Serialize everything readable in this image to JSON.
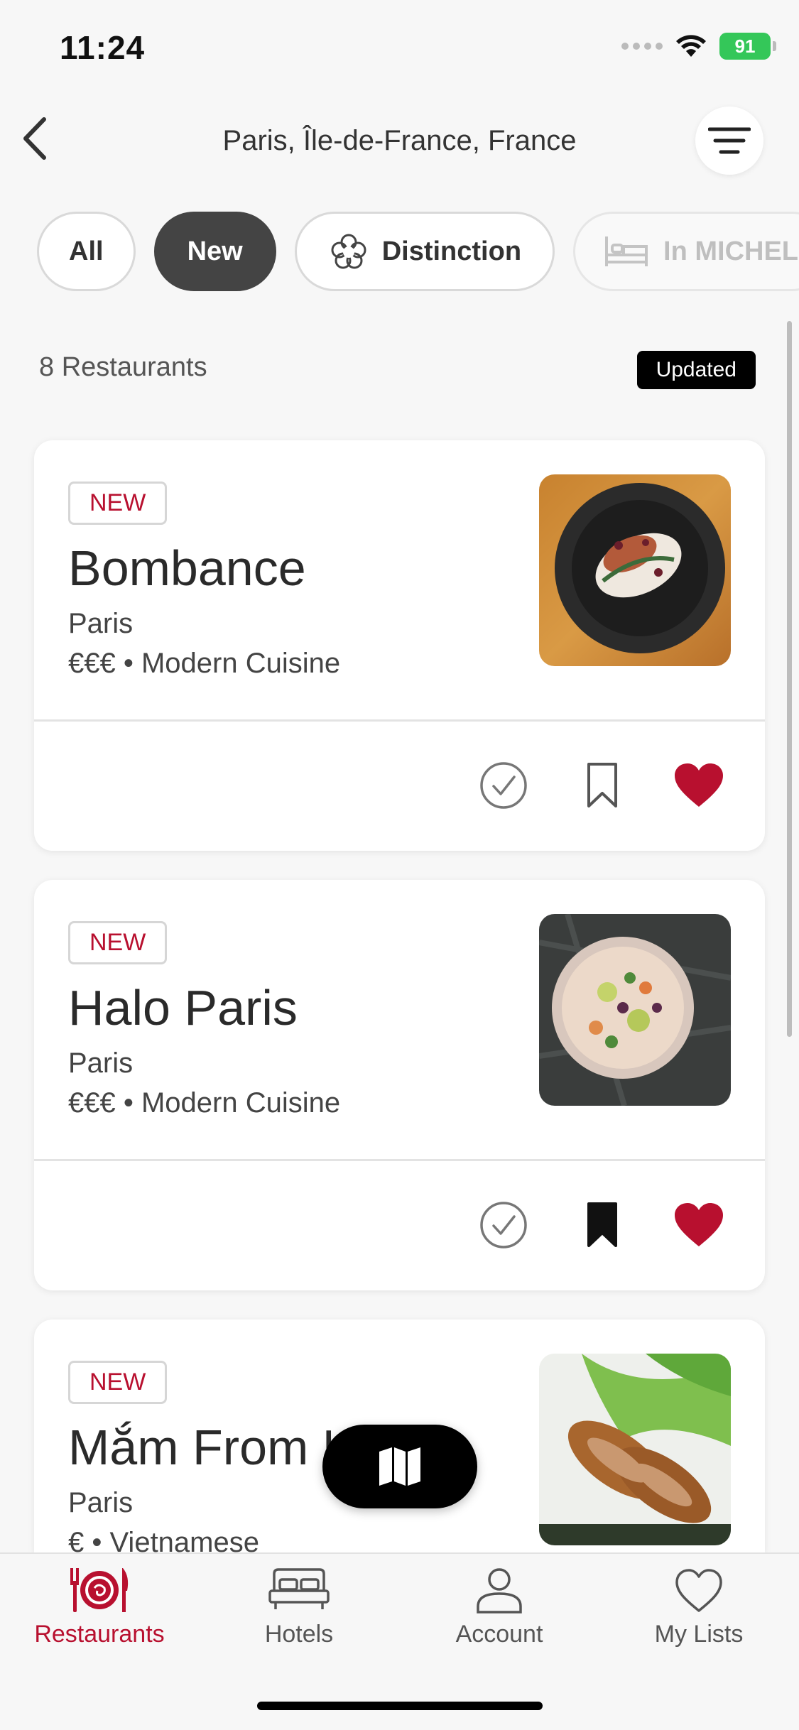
{
  "status_bar": {
    "time": "11:24",
    "battery": "91"
  },
  "header": {
    "title": "Paris, Île-de-France, France"
  },
  "filters": [
    {
      "label": "All"
    },
    {
      "label": "New"
    },
    {
      "label": "Distinction"
    },
    {
      "label": "In MICHEL"
    }
  ],
  "list": {
    "count": "8 Restaurants",
    "updated_badge": "Updated",
    "restaurants": [
      {
        "badge": "NEW",
        "name": "Bombance",
        "city": "Paris",
        "meta": "€€€ • Modern Cuisine",
        "bookmarked": false,
        "favorited": true
      },
      {
        "badge": "NEW",
        "name": "Halo Paris",
        "city": "Paris",
        "meta": "€€€ • Modern Cuisine",
        "bookmarked": true,
        "favorited": true
      },
      {
        "badge": "NEW",
        "name": "Mắm From Hanoï",
        "city": "Paris",
        "meta": "€ • Vietnamese"
      }
    ]
  },
  "tabbar": {
    "tabs": [
      {
        "label": "Restaurants"
      },
      {
        "label": "Hotels"
      },
      {
        "label": "Account"
      },
      {
        "label": "My Lists"
      }
    ]
  },
  "colors": {
    "accent": "#b8102f",
    "active_chip": "#444444",
    "battery": "#34c759"
  }
}
